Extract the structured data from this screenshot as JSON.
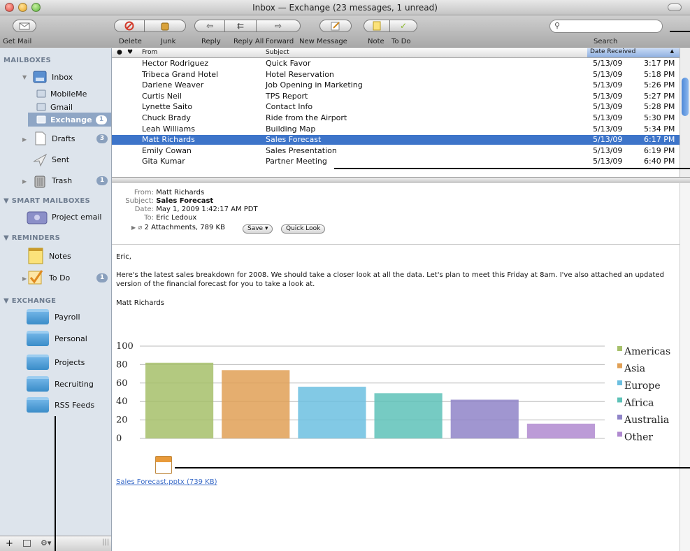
{
  "window": {
    "title": "Inbox — Exchange (23 messages, 1 unread)"
  },
  "toolbar": {
    "get_mail": "Get Mail",
    "delete": "Delete",
    "junk": "Junk",
    "reply": "Reply",
    "reply_all": "Reply All",
    "forward": "Forward",
    "new_message": "New Message",
    "note": "Note",
    "to_do": "To Do",
    "search_label": "Search",
    "search_placeholder": ""
  },
  "sidebar": {
    "mailboxes_header": "MAILBOXES",
    "inbox": "Inbox",
    "mobileme": "MobileMe",
    "gmail": "Gmail",
    "exchange": "Exchange",
    "exchange_badge": "1",
    "drafts": "Drafts",
    "drafts_badge": "3",
    "sent": "Sent",
    "trash": "Trash",
    "trash_badge": "1",
    "smart_header": "SMART MAILBOXES",
    "project_email": "Project email",
    "reminders_header": "REMINDERS",
    "notes": "Notes",
    "todo": "To Do",
    "todo_badge": "1",
    "exchange_header": "EXCHANGE",
    "folders": [
      "Payroll",
      "Personal",
      "Projects",
      "Recruiting",
      "RSS Feeds"
    ]
  },
  "columns": {
    "from": "From",
    "subject": "Subject",
    "date": "Date Received"
  },
  "messages": [
    {
      "from": "Hector Rodriguez",
      "subject": "Quick Favor",
      "date": "5/13/09",
      "time": "3:17 PM"
    },
    {
      "from": "Tribeca Grand Hotel",
      "subject": "Hotel Reservation",
      "date": "5/13/09",
      "time": "5:18 PM"
    },
    {
      "from": "Darlene Weaver",
      "subject": "Job Opening in Marketing",
      "date": "5/13/09",
      "time": "5:26 PM"
    },
    {
      "from": "Curtis Neil",
      "subject": "TPS Report",
      "date": "5/13/09",
      "time": "5:27 PM"
    },
    {
      "from": "Lynette Saito",
      "subject": "Contact Info",
      "date": "5/13/09",
      "time": "5:28 PM"
    },
    {
      "from": "Chuck Brady",
      "subject": "Ride from the Airport",
      "date": "5/13/09",
      "time": "5:30 PM"
    },
    {
      "from": "Leah Williams",
      "subject": "Building Map",
      "date": "5/13/09",
      "time": "5:34 PM"
    },
    {
      "from": "Matt Richards",
      "subject": "Sales Forecast",
      "date": "5/13/09",
      "time": "6:17 PM"
    },
    {
      "from": "Emily Cowan",
      "subject": "Sales Presentation",
      "date": "5/13/09",
      "time": "6:19 PM"
    },
    {
      "from": "Gita Kumar",
      "subject": "Partner Meeting",
      "date": "5/13/09",
      "time": "6:40 PM"
    }
  ],
  "selected_index": 7,
  "message": {
    "from_label": "From:",
    "from": "Matt Richards",
    "subject_label": "Subject:",
    "subject": "Sales Forecast",
    "date_label": "Date:",
    "date": "May 1, 2009 1:42:17 AM PDT",
    "to_label": "To:",
    "to": "Eric Ledoux",
    "attachments": "2 Attachments, 789 KB",
    "save_btn": "Save ▾",
    "quicklook_btn": "Quick Look",
    "greeting": "Eric,",
    "body_line1": "Here's the latest sales breakdown for 2008.  We should take a closer look at all the data.  Let's plan to meet this Friday at 8am. I've also attached an updated",
    "body_line2": "version of the financial forecast for you to take a look at.",
    "signature": "Matt Richards",
    "attachment_name": "Sales Forecast.pptx (739 KB)"
  },
  "chart_data": {
    "type": "bar",
    "categories": [
      "Americas",
      "Asia",
      "Europe",
      "Africa",
      "Australia",
      "Other"
    ],
    "values": [
      82,
      74,
      56,
      49,
      42,
      16
    ],
    "colors": [
      "#a6c06a",
      "#e0a056",
      "#6cbfe0",
      "#5ec2b8",
      "#8f84c8",
      "#b08ad0"
    ],
    "ylim": [
      0,
      100
    ],
    "yticks": [
      "0",
      "20",
      "40",
      "60",
      "80",
      "100"
    ],
    "legend_position": "right",
    "grid": true
  }
}
